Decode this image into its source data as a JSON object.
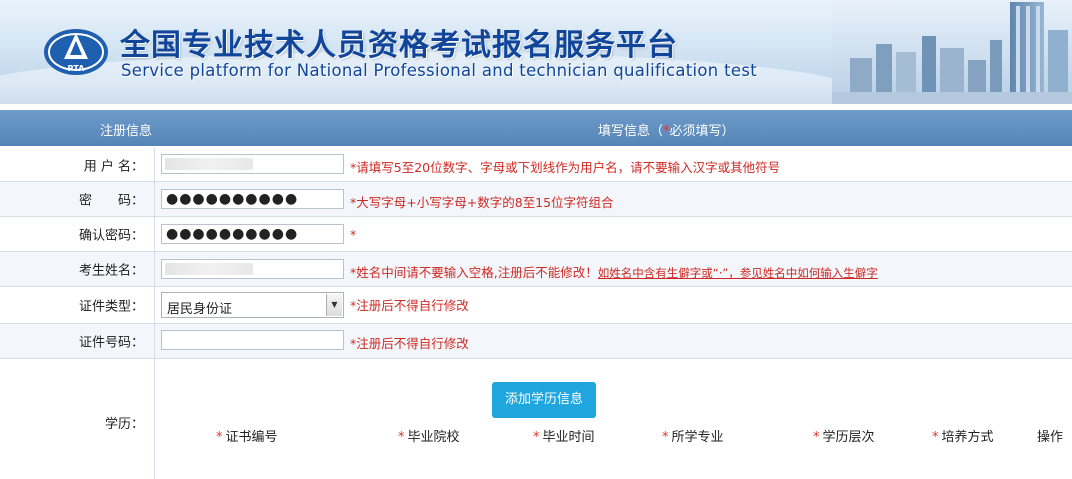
{
  "header": {
    "title_cn": "全国专业技术人员资格考试报名服务平台",
    "title_en": "Service platform for National Professional and technician  qualification test",
    "logo_text": "PTA"
  },
  "bar": {
    "left": "注册信息",
    "right_prefix": "填写信息（",
    "right_star": "*",
    "right_suffix": "必须填写）"
  },
  "form": {
    "username": {
      "label": "用 户 名：",
      "value": "",
      "hint": "*请填写5至20位数字、字母或下划线作为用户名，请不要输入汉字或其他符号"
    },
    "password": {
      "label": "密　　码：",
      "value": "●●●●●●●●●●",
      "hint": "*大写字母+小写字母+数字的8至15位字符组合"
    },
    "confirm": {
      "label": "确认密码：",
      "value": "●●●●●●●●●●",
      "hint": "*"
    },
    "name": {
      "label": "考生姓名：",
      "value": "",
      "hint": "*姓名中间请不要输入空格,注册后不能修改！",
      "link": "如姓名中含有生僻字或“·”，参见姓名中如何输入生僻字"
    },
    "id_type": {
      "label": "证件类型：",
      "value": "居民身份证",
      "hint": "*注册后不得自行修改"
    },
    "id_number": {
      "label": "证件号码：",
      "value": "",
      "hint": "*注册后不得自行修改"
    },
    "education": {
      "label": "学历：",
      "add_button": "添加学历信息",
      "columns": [
        "证书编号",
        "毕业院校",
        "毕业时间",
        "所学专业",
        "学历层次",
        "培养方式"
      ],
      "action_column": "操作",
      "required_mark": "*"
    }
  }
}
